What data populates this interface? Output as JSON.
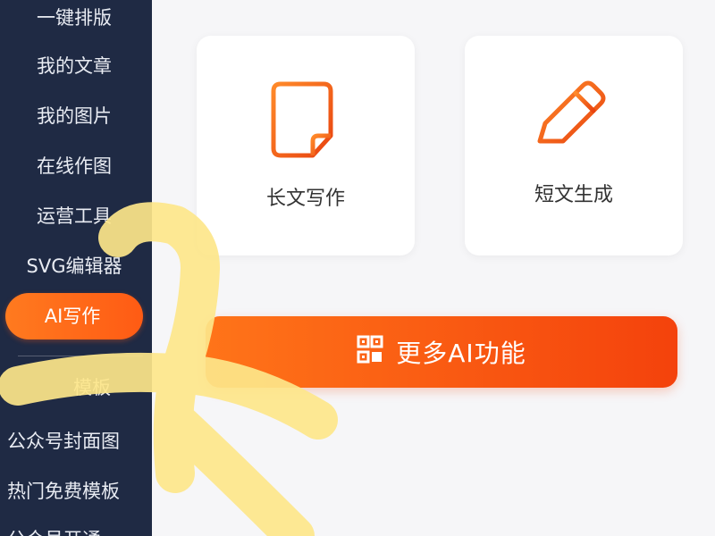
{
  "sidebar": {
    "items": [
      {
        "label": "一键排版"
      },
      {
        "label": "我的文章"
      },
      {
        "label": "我的图片"
      },
      {
        "label": "在线作图"
      },
      {
        "label": "运营工具"
      },
      {
        "label": "SVG编辑器"
      },
      {
        "label": "AI写作",
        "active": true
      },
      {
        "label": "模板"
      },
      {
        "label": "公众号封面图"
      },
      {
        "label": "热门免费模板"
      },
      {
        "label": "公众号开通"
      }
    ]
  },
  "main": {
    "cards": [
      {
        "label": "长文写作",
        "icon": "document-icon"
      },
      {
        "label": "短文生成",
        "icon": "pencil-icon"
      }
    ],
    "more_button": {
      "label": "更多AI功能",
      "icon": "grid-icon"
    }
  },
  "colors": {
    "sidebar_bg": "#1f2a44",
    "accent": "#ff6a1a",
    "highlighter": "#fde68a"
  }
}
